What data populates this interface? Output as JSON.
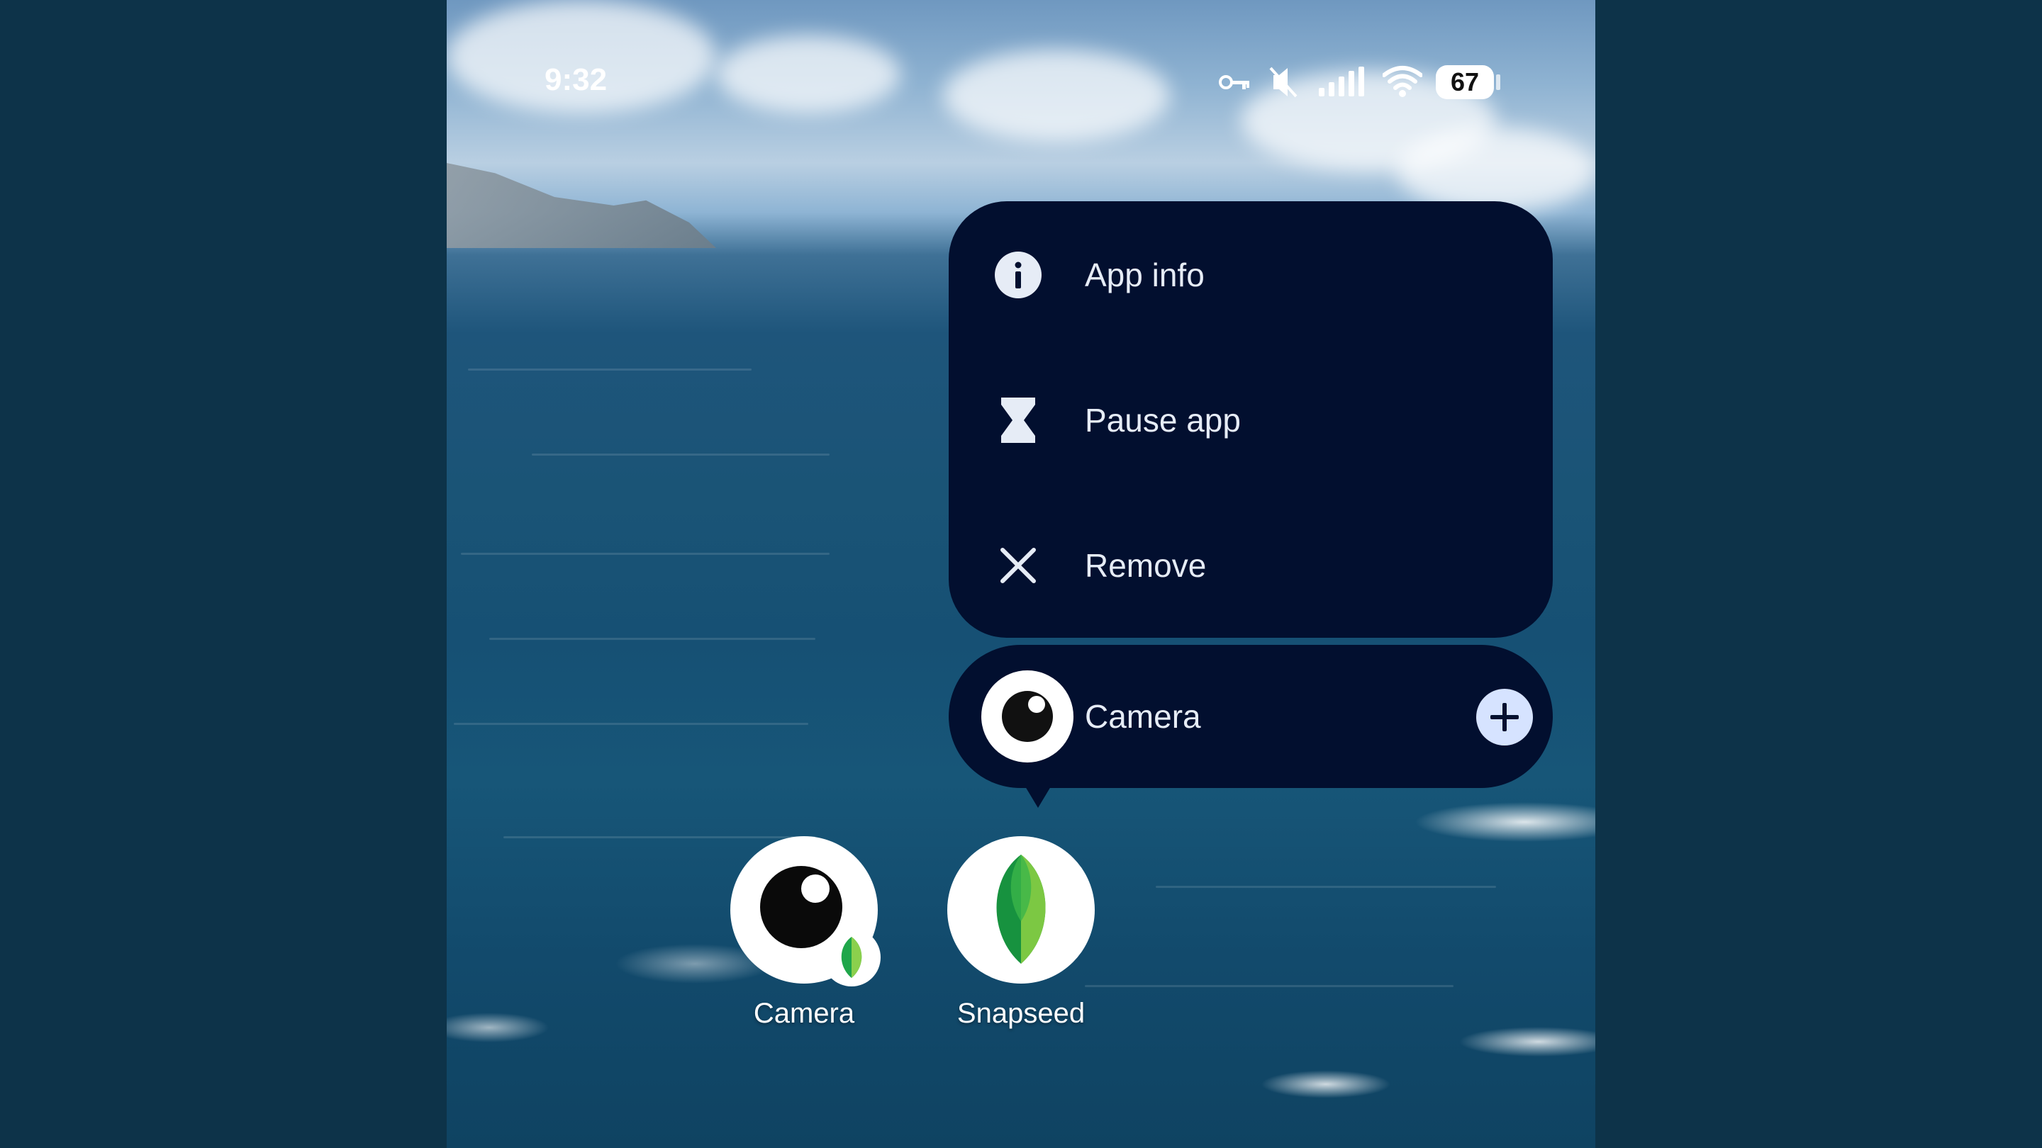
{
  "status_bar": {
    "time": "9:32",
    "battery": "67",
    "icons": [
      "vpn-key-icon",
      "mute-icon",
      "signal-icon",
      "wifi-icon",
      "battery-icon"
    ]
  },
  "context_menu": {
    "items": [
      {
        "label": "App info",
        "icon": "info-icon"
      },
      {
        "label": "Pause app",
        "icon": "hourglass-icon"
      },
      {
        "label": "Remove",
        "icon": "close-icon"
      }
    ],
    "widget_shortcut": {
      "label": "Camera",
      "icon": "camera-app-icon",
      "action_icon": "plus-icon"
    }
  },
  "home_apps": [
    {
      "label": "Camera",
      "icon": "camera-app-icon",
      "badge": "snapseed-leaf-icon"
    },
    {
      "label": "Snapseed",
      "icon": "snapseed-leaf-icon"
    }
  ],
  "colors": {
    "menu_background": "#020f2f",
    "menu_text": "#e6ecf6",
    "add_button": "#d6e3ff",
    "page_background": "#0d3349"
  }
}
